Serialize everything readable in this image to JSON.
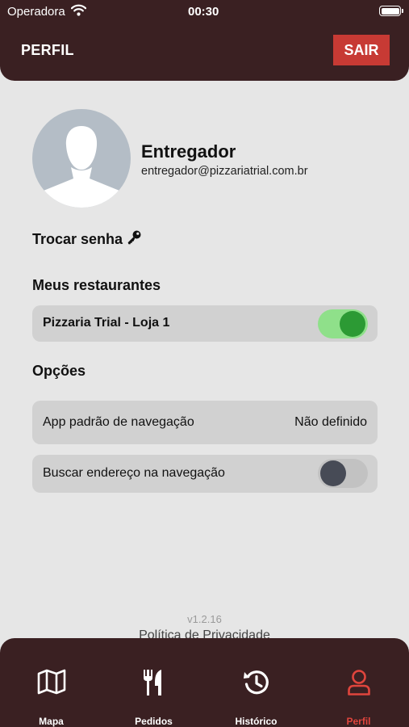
{
  "status_bar": {
    "carrier": "Operadora",
    "time": "00:30"
  },
  "header": {
    "title": "PERFIL",
    "logout_label": "SAIR"
  },
  "profile": {
    "name": "Entregador",
    "email": "entregador@pizzariatrial.com.br"
  },
  "change_password_label": "Trocar senha",
  "restaurants": {
    "heading": "Meus restaurantes",
    "items": [
      {
        "name": "Pizzaria Trial - Loja 1",
        "enabled": true
      }
    ]
  },
  "options": {
    "heading": "Opções",
    "nav_app": {
      "label": "App padrão de navegação",
      "value": "Não definido"
    },
    "search_address": {
      "label": "Buscar endereço na navegação",
      "enabled": false
    }
  },
  "footer": {
    "version": "v1.2.16",
    "privacy_link": "Política de Privacidade"
  },
  "tabs": [
    {
      "label": "Mapa",
      "icon": "map-icon",
      "active": false
    },
    {
      "label": "Pedidos",
      "icon": "fork-knife-icon",
      "active": false
    },
    {
      "label": "Histórico",
      "icon": "history-icon",
      "active": false
    },
    {
      "label": "Perfil",
      "icon": "user-icon",
      "active": true
    }
  ],
  "colors": {
    "primary": "#3a2022",
    "accent": "#c73a34",
    "active_tab": "#e0453d",
    "toggle_on": "#2c9a34"
  }
}
